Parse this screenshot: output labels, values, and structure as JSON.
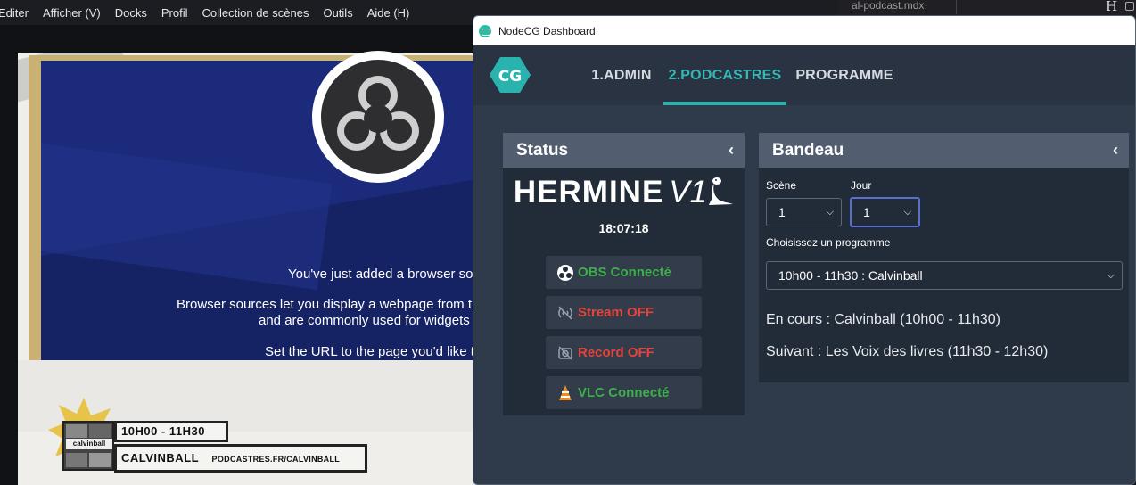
{
  "obs": {
    "menu": [
      "Editer",
      "Afficher (V)",
      "Docks",
      "Profil",
      "Collection de scènes",
      "Outils",
      "Aide (H)"
    ],
    "bg_tab": "al-podcast.mdx",
    "bg_letter": "H",
    "preview": {
      "line1": "You've just added a browser so",
      "line2": "Browser sources let you display a webpage from t",
      "line3": "and are commonly used for widgets",
      "line4": "Set the URL to the page you'd like t"
    },
    "badge": {
      "image_label": "calvinball",
      "time": "10H00 - 11H30",
      "name": "CALVINBALL",
      "url": "PODCASTRES.FR/CALVINBALL"
    }
  },
  "window": {
    "title": "NodeCG Dashboard",
    "logo_text": "CG",
    "tabs": [
      {
        "label": "1.ADMIN",
        "active": false
      },
      {
        "label": "2.PODCASTRES",
        "active": true
      },
      {
        "label": "PROGRAMME",
        "active": false
      }
    ],
    "accent": "#2ab3ae"
  },
  "status": {
    "header": "Status",
    "collapse_icon": "chevron-left-icon",
    "brand_main": "HERMINE",
    "brand_version": "V1",
    "clock": "18:07:18",
    "buttons": [
      {
        "label": "OBS Connecté",
        "icon": "obs-icon",
        "color": "#3fae4d"
      },
      {
        "label": "Stream OFF",
        "icon": "stream-off-icon",
        "color": "#e5443d"
      },
      {
        "label": "Record OFF",
        "icon": "record-off-icon",
        "color": "#e5443d"
      },
      {
        "label": "VLC Connecté",
        "icon": "vlc-icon",
        "color": "#3fae4d"
      }
    ]
  },
  "bandeau": {
    "header": "Bandeau",
    "collapse_icon": "chevron-left-icon",
    "scene_label": "Scène",
    "scene_value": "1",
    "jour_label": "Jour",
    "jour_value": "1",
    "programme_label": "Choisissez un programme",
    "programme_value": "10h00 - 11h30 : Calvinball",
    "en_cours": "En cours : Calvinball (10h00 - 11h30)",
    "suivant": "Suivant : Les Voix des livres (11h30 - 12h30)"
  }
}
